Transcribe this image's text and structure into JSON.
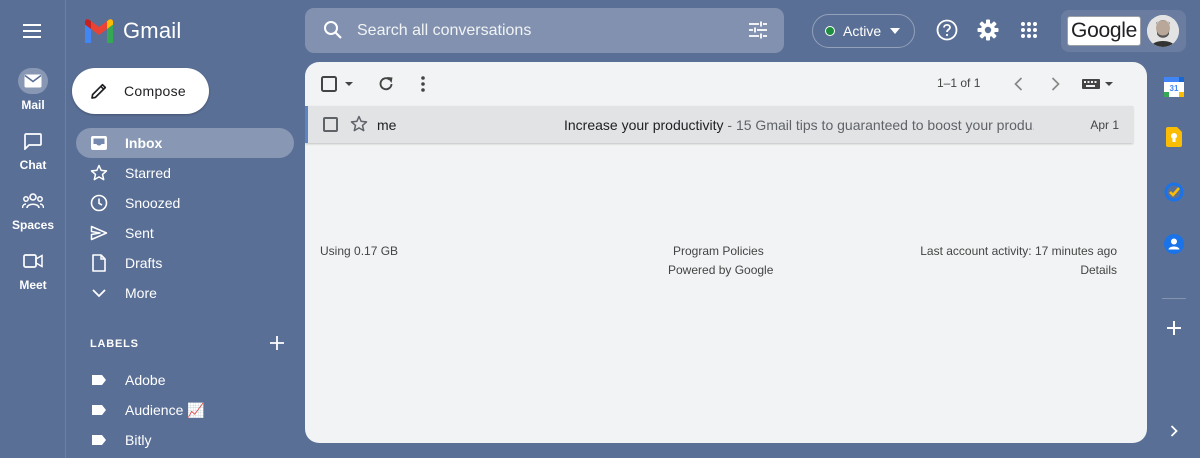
{
  "app": {
    "name": "Gmail"
  },
  "rail": {
    "items": [
      {
        "label": "Mail",
        "icon": "mail-icon"
      },
      {
        "label": "Chat",
        "icon": "chat-icon"
      },
      {
        "label": "Spaces",
        "icon": "spaces-icon"
      },
      {
        "label": "Meet",
        "icon": "meet-icon"
      }
    ]
  },
  "search": {
    "placeholder": "Search all conversations"
  },
  "status": {
    "label": "Active",
    "color": "#1e8e3e"
  },
  "header": {
    "google_badge": "Google"
  },
  "compose": {
    "label": "Compose"
  },
  "nav": {
    "items": [
      {
        "label": "Inbox",
        "icon": "inbox-icon"
      },
      {
        "label": "Starred",
        "icon": "star-icon"
      },
      {
        "label": "Snoozed",
        "icon": "clock-icon"
      },
      {
        "label": "Sent",
        "icon": "send-icon"
      },
      {
        "label": "Drafts",
        "icon": "draft-icon"
      },
      {
        "label": "More",
        "icon": "chevron-down-icon"
      }
    ],
    "labels_header": "LABELS",
    "labels": [
      {
        "label": "Adobe"
      },
      {
        "label": "Audience 📈"
      },
      {
        "label": "Bitly"
      }
    ]
  },
  "toolbar": {
    "pager": "1–1 of 1"
  },
  "messages": [
    {
      "sender": "me",
      "subject": "Increase your productivity",
      "snippet": " - 15 Gmail tips to guaranteed to boost your produ...",
      "date": "Apr 1"
    }
  ],
  "footer": {
    "storage": "Using 0.17 GB",
    "policies": "Program Policies",
    "powered": "Powered by Google",
    "activity": "Last account activity: 17 minutes ago",
    "details": "Details"
  },
  "colors": {
    "background": "#5a6f96",
    "panel": "#f1f3f4",
    "selected_row": "#e2e3e5"
  }
}
